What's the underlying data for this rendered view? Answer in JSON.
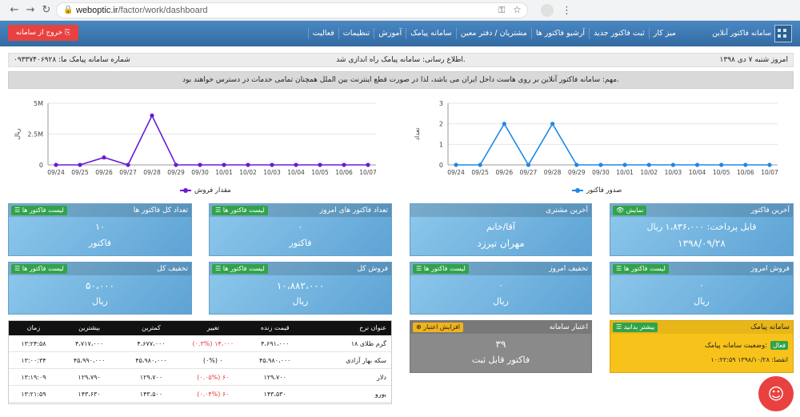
{
  "browser": {
    "url_host": "weboptic.ir",
    "url_path": "/factor/work/dashboard"
  },
  "navbar": {
    "brand": "سامانه فاکتور آنلاین",
    "logout": "خروج از سامانه",
    "menu": [
      "میز کار",
      "ثبت فاکتور جدید",
      "آرشیو فاکتور ها",
      "مشتریان / دفتر معین",
      "سامانه پیامک",
      "آموزش",
      "تنظیمات",
      "فعالیت"
    ]
  },
  "infobar": {
    "date": "امروز شنبه ۷ دی ۱۳۹۸",
    "notice": "اطلاع رسانی: سامانه پیامک راه اندازی شد.",
    "sms_number": "شماره سامانه پیامک ما: ۰۹۳۳۷۴۰۶۹۲۸"
  },
  "important": "مهم: سامانه فاکتور آنلاین بر روی هاست داخل ایران می باشد، لذا در صورت قطع اینترنت بین الملل همچنان تمامی خدمات در دسترس خواهند بود.",
  "chart_data": [
    {
      "type": "line",
      "categories": [
        "09/24",
        "09/25",
        "09/26",
        "09/27",
        "09/28",
        "09/29",
        "09/30",
        "10/01",
        "10/02",
        "10/03",
        "10/04",
        "10/05",
        "10/06",
        "10/07"
      ],
      "series": [
        {
          "name": "صدور فاکتور",
          "values": [
            0,
            0,
            2,
            0,
            2,
            0,
            0,
            0,
            0,
            0,
            0,
            0,
            0,
            0
          ]
        }
      ],
      "ylabel": "تعداد",
      "ylim": [
        0,
        3
      ],
      "yticks": [
        "0",
        "1",
        "2",
        "3"
      ],
      "color": "#1e88e5",
      "legend": "bottom"
    },
    {
      "type": "line",
      "categories": [
        "09/24",
        "09/25",
        "09/26",
        "09/27",
        "09/28",
        "09/29",
        "09/30",
        "10/01",
        "10/02",
        "10/03",
        "10/04",
        "10/05",
        "10/06",
        "10/07"
      ],
      "series": [
        {
          "name": "مقدار فروش",
          "values": [
            0,
            0,
            600000,
            0,
            4000000,
            0,
            0,
            0,
            0,
            0,
            0,
            0,
            0,
            0
          ]
        }
      ],
      "ylabel": "ریال",
      "ylim": [
        0,
        5000000
      ],
      "yticks": [
        "0",
        "2.5M",
        "5M"
      ],
      "color": "#6a1bd6",
      "legend": "bottom"
    }
  ],
  "cards": {
    "last_invoice": {
      "title": "آخرین فاکتور",
      "btn": "نمایش",
      "v1": "قابل پرداخت: ۱،۸۳۶،۰۰۰ ریال",
      "v2": "۱۳۹۸/۰۹/۲۸"
    },
    "last_customer": {
      "title": "آخرین مشتری",
      "v1": "آقا/خانم",
      "v2": "مهران تیرزد"
    },
    "today_count": {
      "title": "تعداد فاکتور های امروز",
      "btn": "لیست فاکتور ها",
      "v1": "۰",
      "v2": "فاکتور"
    },
    "total_count": {
      "title": "تعداد کل فاکتور ها",
      "btn": "لیست فاکتور ها",
      "v1": "۱۰",
      "v2": "فاکتور"
    },
    "today_sales": {
      "title": "فروش امروز",
      "btn": "لیست فاکتور ها",
      "v1": "۰",
      "v2": "ریال"
    },
    "today_discount": {
      "title": "تخفیف امروز",
      "btn": "لیست فاکتور ها",
      "v1": "۰",
      "v2": "ریال"
    },
    "total_sales": {
      "title": "فروش کل",
      "btn": "لیست فاکتور ها",
      "v1": "۱۰،۸۸۲،۰۰۰",
      "v2": "ریال"
    },
    "total_discount": {
      "title": "تخفیف کل",
      "btn": "لیست فاکتور ها",
      "v1": "۵۰،۰۰۰",
      "v2": "ریال"
    }
  },
  "credit": {
    "title": "اعتبار سامانه",
    "btn": "افزایش اعتبار",
    "v1": "۳۹",
    "v2": "فاکتور قابل ثبت"
  },
  "sms": {
    "title": "سامانه پیامک",
    "btn": "بیشتر بدانید",
    "status_label": "وضعیت سامانه پیامک:",
    "status": "فعال",
    "expire": "انقضا: ۱۳۹۸/۱۰/۲۸ ۱۰:۲۲:۵۹"
  },
  "rates": {
    "headers": [
      "عنوان نرخ",
      "قیمت زنده",
      "تغییر",
      "کمترین",
      "بیشترین",
      "زمان"
    ],
    "rows": [
      [
        "گرم طلای ۱۸",
        "۴،۶۹۱،۰۰۰",
        "(۰.۳%) ۱۴،۰۰۰",
        "۴،۶۷۷،۰۰۰",
        "۴،۷۱۷،۰۰۰",
        "۱۳:۲۴:۵۸"
      ],
      [
        "سکه بهار آزادی",
        "۴۵،۹۸۰،۰۰۰",
        "(۰%) ۰",
        "۴۵،۹۸۰،۰۰۰",
        "۴۵،۹۹۰،۰۰۰",
        "۱۳:۰۰:۳۴"
      ],
      [
        "دلار",
        "۱۲۹،۷۰۰",
        "(۰.۰۵%) ۶۰",
        "۱۲۹،۷۰۰",
        "۱۲۹،۷۹۰",
        "۱۳:۱۹:۰۹"
      ],
      [
        "یورو",
        "۱۴۳،۵۳۰",
        "(۰.۰۴%) ۶۰",
        "۱۴۳،۵۰۰",
        "۱۴۳،۶۳۰",
        "۱۳:۲۱:۵۹"
      ]
    ],
    "neg_col": 2
  }
}
